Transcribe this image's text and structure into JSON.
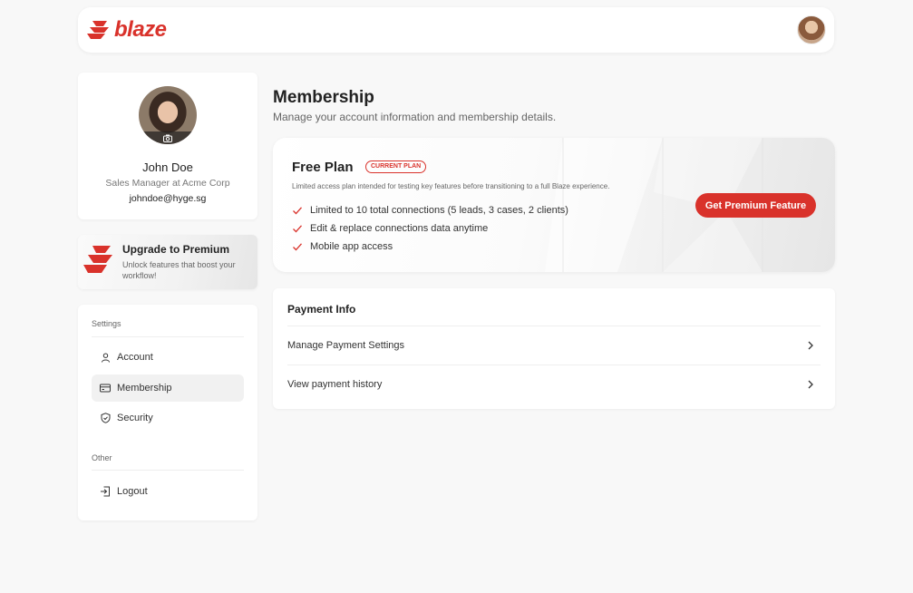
{
  "header": {
    "brand": "blaze",
    "accent_color": "#d9322b",
    "avatar_icon": "user-avatar"
  },
  "profile": {
    "name": "John Doe",
    "role": "Sales Manager at Acme Corp",
    "email": "johndoe@hyge.sg",
    "camera_icon": "camera-icon"
  },
  "upgrade": {
    "title": "Upgrade to Premium",
    "subtitle": "Unlock features that boost your workflow!"
  },
  "sidebar": {
    "settings_label": "Settings",
    "other_label": "Other",
    "items": [
      {
        "label": "Account",
        "icon": "user-icon",
        "active": false
      },
      {
        "label": "Membership",
        "icon": "card-icon",
        "active": true
      },
      {
        "label": "Security",
        "icon": "shield-icon",
        "active": false
      }
    ],
    "logout_label": "Logout"
  },
  "main": {
    "title": "Membership",
    "subtitle": "Manage your account information and membership details."
  },
  "plan": {
    "name": "Free Plan",
    "badge": "CURRENT PLAN",
    "description": "Limited access plan intended for testing key features before transitioning to a full Blaze experience.",
    "features": [
      "Limited to 10 total connections (5 leads, 3 cases, 2 clients)",
      "Edit & replace connections data anytime",
      "Mobile app access"
    ],
    "cta_label": "Get Premium Feature"
  },
  "payment": {
    "title": "Payment Info",
    "rows": [
      {
        "label": "Manage Payment Settings"
      },
      {
        "label": "View payment history"
      }
    ]
  }
}
